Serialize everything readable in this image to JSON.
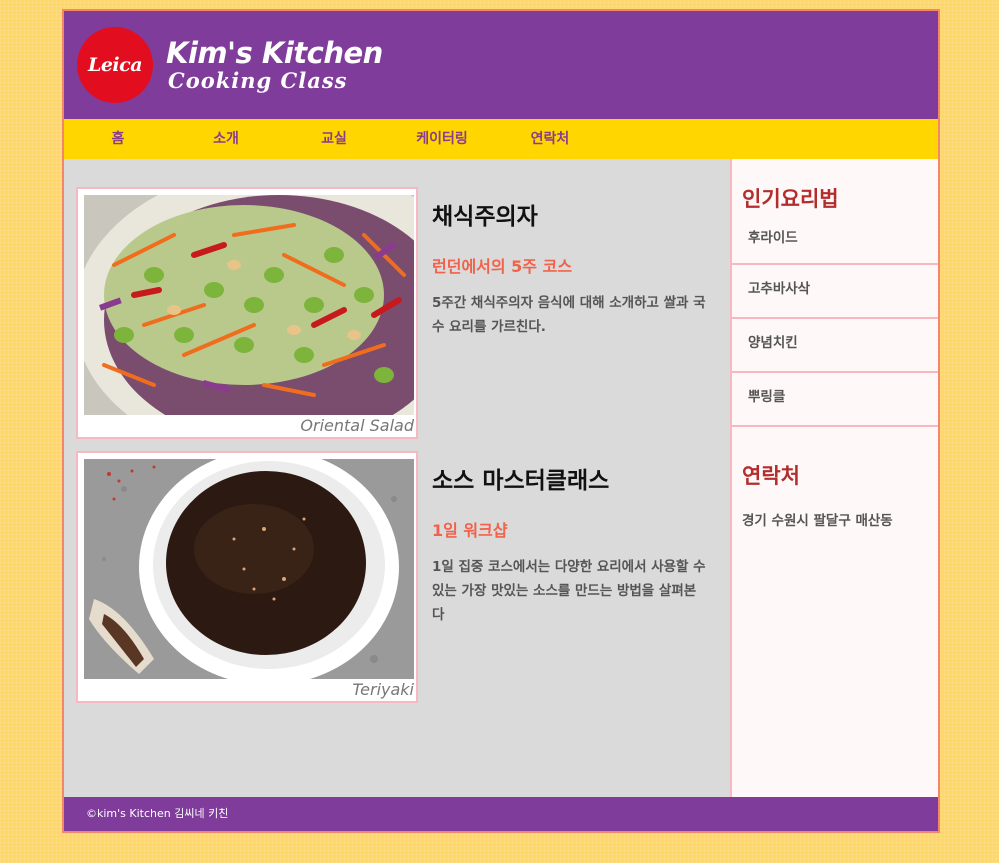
{
  "brand": {
    "logo_text": "Leica",
    "title": "Kim's Kitchen",
    "subtitle": "Cooking Class"
  },
  "nav": {
    "items": [
      {
        "label": "홈"
      },
      {
        "label": "소개"
      },
      {
        "label": "교실"
      },
      {
        "label": "케이터링"
      },
      {
        "label": "연락처"
      }
    ]
  },
  "courses": [
    {
      "title": "채식주의자",
      "subtitle": "런던에서의 5주 코스",
      "description": "5주간 채식주의자 음식에 대해 소개하고 쌀과 국수 요리를 가르친다.",
      "image_caption": "Oriental Salad"
    },
    {
      "title": "소스 마스터클래스",
      "subtitle": "1일 워크샵",
      "description": "1일 집중 코스에서는 다양한 요리에서 사용할 수 있는 가장 맛있는 소스를 만드는 방법을 살펴본다",
      "image_caption": "Teriyaki"
    }
  ],
  "sidebar": {
    "popular_heading": "인기요리법",
    "recipes": [
      {
        "label": "후라이드"
      },
      {
        "label": "고추바사삭"
      },
      {
        "label": "양념치킨"
      },
      {
        "label": "뿌링클"
      }
    ],
    "contact_heading": "연락처",
    "address": "경기 수원시 팔달구 매산동"
  },
  "footer": {
    "text": "©kim's Kitchen 김씨네 키친"
  },
  "colors": {
    "header_bg": "#7f3c9b",
    "nav_bg": "#ffd600",
    "nav_text": "#8a3d8a",
    "accent": "#f2624a",
    "sidebar_heading": "#b42d2d",
    "logo_red": "#e20e1f"
  }
}
